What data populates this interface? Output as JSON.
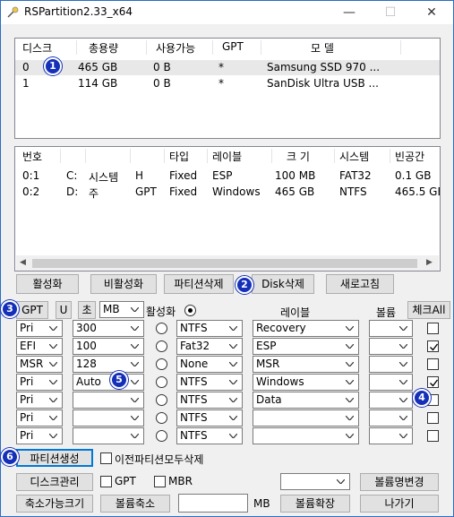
{
  "window": {
    "title": "RSPartition2.33_x64",
    "controls": [
      "—",
      "☐",
      "✕"
    ]
  },
  "disk_list": {
    "headers": [
      "디스크",
      "총용량",
      "사용가능",
      "GPT",
      "모  델"
    ],
    "rows": [
      [
        "0",
        "465 GB",
        "0 B",
        "*",
        "Samsung SSD 970 ..."
      ],
      [
        "1",
        "114 GB",
        "0 B",
        "*",
        "SanDisk Ultra USB ..."
      ]
    ]
  },
  "partition_list": {
    "headers": [
      "번호",
      "",
      "",
      "",
      "타입",
      "레이블",
      "크 기",
      "시스템",
      "빈공간"
    ],
    "rows": [
      [
        "0:1",
        "C:",
        "시스템",
        "H",
        "Fixed",
        "ESP",
        "100 MB",
        "FAT32",
        "0.1 GB"
      ],
      [
        "0:2",
        "D:",
        "주",
        "GPT",
        "Fixed",
        "Windows",
        "465 GB",
        "NTFS",
        "465.5 GE"
      ]
    ]
  },
  "action_buttons": [
    "활성화",
    "비활성화",
    "파티션삭제",
    "Disk삭제",
    "새로고침"
  ],
  "create_header": {
    "gpt": "GPT",
    "u": "U",
    "cho": "초",
    "unit": "MB",
    "active_label": "활성화",
    "label_header": "레이블",
    "volume_header": "볼륨",
    "check_all": "체크All"
  },
  "partition_rows": [
    {
      "type": "Pri",
      "size": "300",
      "fs": "NTFS",
      "label": "Recovery",
      "volume": "",
      "checked": false
    },
    {
      "type": "EFI",
      "size": "100",
      "fs": "Fat32",
      "label": "ESP",
      "volume": "",
      "checked": true
    },
    {
      "type": "MSR",
      "size": "128",
      "fs": "None",
      "label": "MSR",
      "volume": "",
      "checked": false
    },
    {
      "type": "Pri",
      "size": "Auto",
      "fs": "NTFS",
      "label": "Windows",
      "volume": "",
      "checked": true
    },
    {
      "type": "Pri",
      "size": "",
      "fs": "NTFS",
      "label": "Data",
      "volume": "",
      "checked": false
    },
    {
      "type": "Pri",
      "size": "",
      "fs": "NTFS",
      "label": "",
      "volume": "",
      "checked": false
    },
    {
      "type": "Pri",
      "size": "",
      "fs": "NTFS",
      "label": "",
      "volume": "",
      "checked": false
    }
  ],
  "bottom": {
    "create_btn": "파티션생성",
    "delete_prev": "이전파티션모두삭제",
    "disk_mgmt": "디스크관리",
    "gpt": "GPT",
    "mbr": "MBR",
    "rename_vol": "볼륨명변경",
    "shrinkable": "축소가능크기",
    "shrink": "볼륨축소",
    "mb": "MB",
    "extend": "볼륨확장",
    "exit": "나가기"
  },
  "badges": [
    "1",
    "2",
    "3",
    "4",
    "5",
    "6"
  ],
  "colors": {
    "badge": "#1530b8",
    "focus": "#0078d7"
  }
}
